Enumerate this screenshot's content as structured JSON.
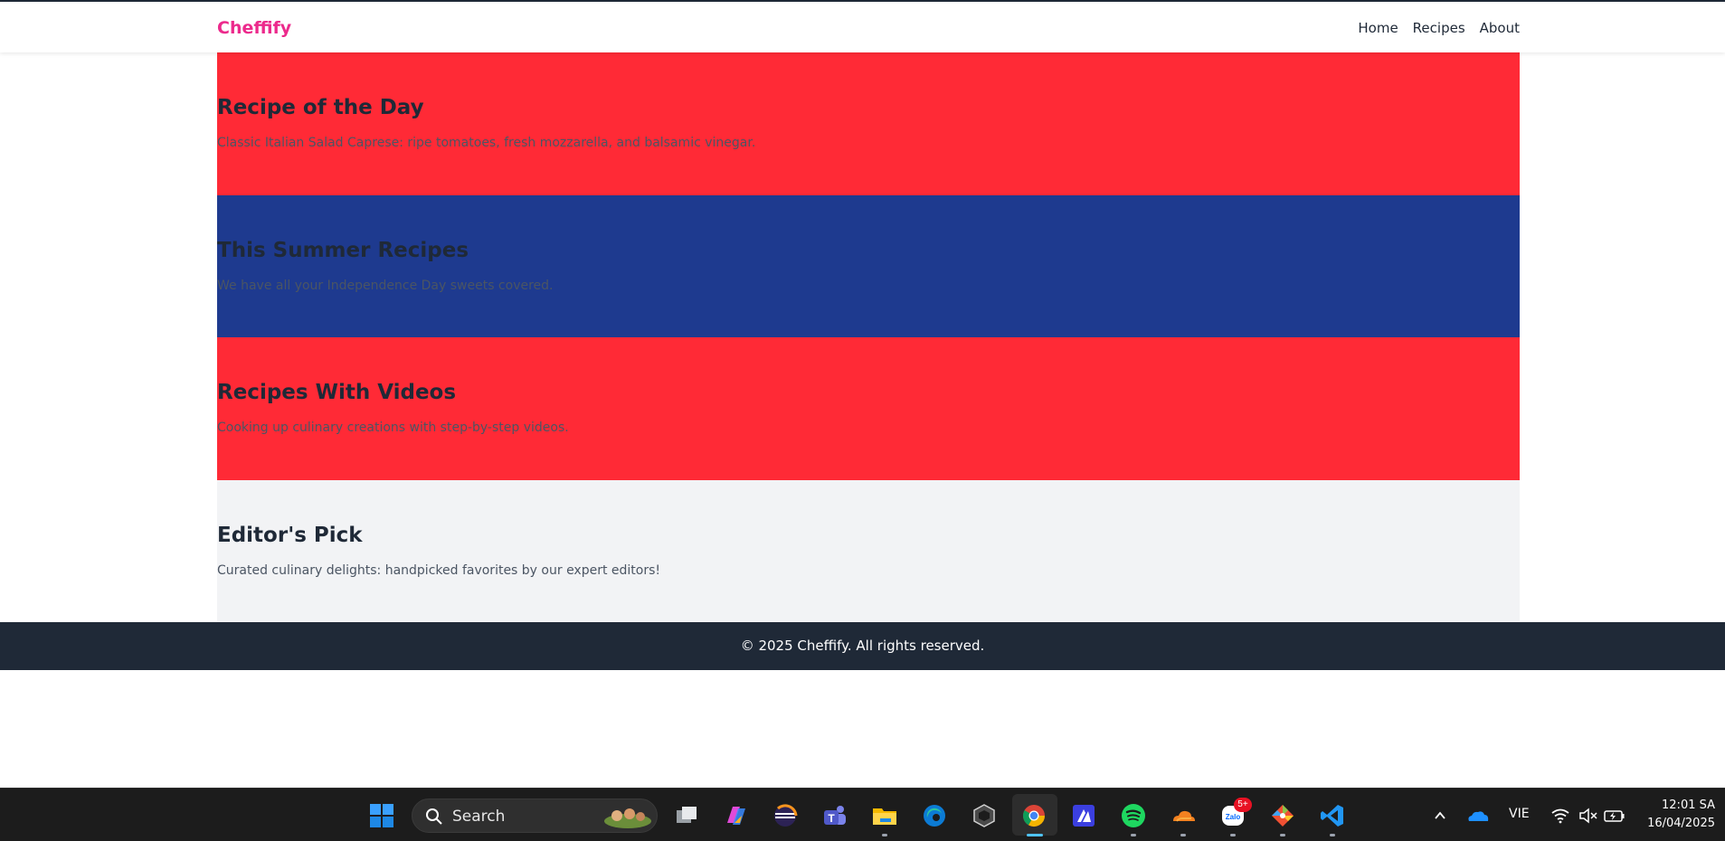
{
  "header": {
    "brand": "Cheffify",
    "nav": [
      "Home",
      "Recipes",
      "About"
    ]
  },
  "sections": [
    {
      "title": "Recipe of the Day",
      "text": "Classic Italian Salad Caprese: ripe tomatoes, fresh mozzarella, and balsamic vinegar.",
      "bg": "#ff2a36"
    },
    {
      "title": "This Summer Recipes",
      "text": "We have all your Independence Day sweets covered.",
      "bg": "#1e3a8f"
    },
    {
      "title": "Recipes With Videos",
      "text": "Cooking up culinary creations with step-by-step videos.",
      "bg": "#ff2a36"
    },
    {
      "title": "Editor's Pick",
      "text": "Curated culinary delights: handpicked favorites by our expert editors!",
      "bg": "#f2f3f5"
    }
  ],
  "footer": {
    "text": "© 2025 Cheffify. All rights reserved."
  },
  "taskbar": {
    "search_label": "Search",
    "apps": [
      "windows-start",
      "task-view",
      "copilot",
      "eclipse",
      "teams",
      "file-explorer",
      "edge",
      "unity",
      "chrome",
      "mail",
      "spotify",
      "cloudflare",
      "zalo",
      "git",
      "vscode"
    ],
    "zalo_badge": "5+",
    "language": "VIE",
    "time": "12:01 SA",
    "date": "16/04/2025"
  },
  "colors": {
    "brand": "#ec2a8c",
    "red": "#ff2a36",
    "blue": "#1e3a8f",
    "footer": "#1f2937"
  }
}
